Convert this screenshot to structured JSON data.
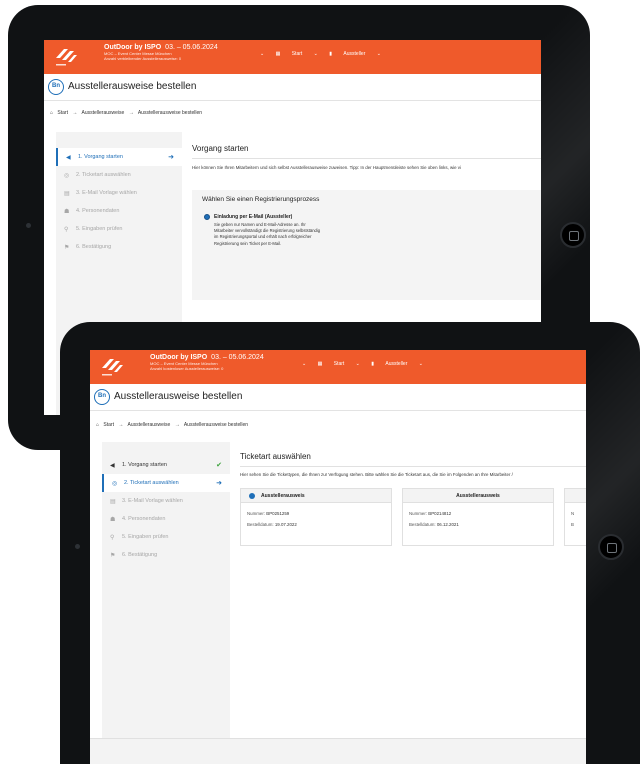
{
  "brand": {
    "name": "OutDoor by ISPO",
    "dates": "03. – 05.06.2024",
    "venue": "MOC – Event Center Messe München",
    "quota_back": "Anzahl verbleibender Ausstellerausweise: 0",
    "quota_front": "Anzahl kostenloser Ausstellerausweise: 0"
  },
  "topnav": {
    "dropdown": "⌄",
    "start": "Start",
    "exhibitor": "Aussteller"
  },
  "page": {
    "title": "Ausstellerausweise bestellen",
    "icon_text": "Bn"
  },
  "breadcrumb": {
    "home": "Start",
    "sep": "→",
    "level1": "Ausstellerausweise",
    "level2": "Ausstellerausweise bestellen"
  },
  "back": {
    "steps": [
      "1. Vorgang starten",
      "2. Ticketart auswählen",
      "3. E-Mail Vorlage wählen",
      "4. Personendaten",
      "5. Eingaben prüfen",
      "6. Bestätigung"
    ],
    "heading": "Vorgang starten",
    "intro": "Hier können Sie Ihren Mitarbeitern und sich selbst Ausstellerausweise zuweisen. Tipp: In der Hauptmenüleiste sehen Sie oben links, wie vi",
    "process_heading": "Wählen Sie einen Registrierungsprozess",
    "option_title": "Einladung per E-Mail (Aussteller)",
    "option_desc": "Sie geben nur Namen und E-Mail-Adresse an. Ihr Mitarbeiter vervollständigt die Registrierung selbstständig im Registrierungsportal und erhält nach erfolgreicher Registrierung sein Ticket per E-Mail."
  },
  "front": {
    "steps": [
      "1. Vorgang starten",
      "2. Ticketart auswählen",
      "3. E-Mail Vorlage wählen",
      "4. Personendaten",
      "5. Eingaben prüfen",
      "6. Bestätigung"
    ],
    "heading": "Ticketart auswählen",
    "intro": "Hier sehen Sie die Tickettypen, die Ihnen zur Verfügung stehen. Bitte wählen Sie die Ticketart aus, die Sie im Folgenden an Ihre Mitarbeiter /",
    "cards": [
      {
        "title": "Ausstellerausweis",
        "number_label": "Nummer:",
        "number": "BP0251259",
        "date_label": "Bestelldatum:",
        "date": "19.07.2022"
      },
      {
        "title": "Ausstellerausweis",
        "number_label": "Nummer:",
        "number": "BP0214812",
        "date_label": "Bestelldatum:",
        "date": "06.12.2021"
      },
      {
        "number_label": "N",
        "date_label": "B"
      }
    ]
  },
  "colors": {
    "brand_orange": "#ef5a2b",
    "accent_blue": "#1f6fb8",
    "success_green": "#3aa13a"
  },
  "icons": [
    "logo-mark",
    "arrow-right-icon",
    "check-icon",
    "grid-icon",
    "badge-icon",
    "home-icon",
    "search-icon",
    "mail-template-icon",
    "person-icon",
    "flag-icon",
    "ticket-icon"
  ]
}
